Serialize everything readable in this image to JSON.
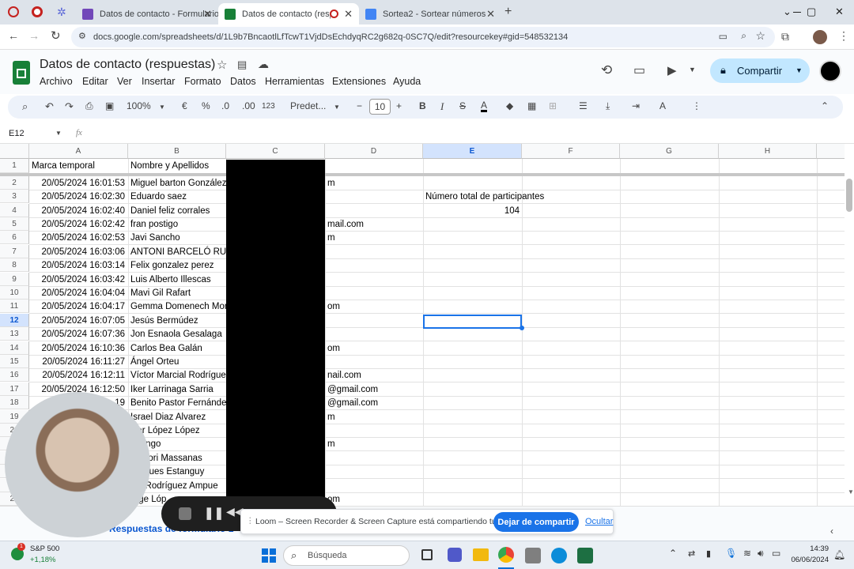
{
  "browser": {
    "tabs": [
      {
        "label": "Datos de contacto - Formulario",
        "active": false,
        "color": "#7248b9"
      },
      {
        "label": "Datos de contacto (respuestas)",
        "active": true,
        "color": "#188038"
      },
      {
        "label": "Sortea2 - Sortear números",
        "active": false,
        "color": "#4285f4"
      }
    ],
    "url": "docs.google.com/spreadsheets/d/1L9b7BncaotlLfTcwT1VjdDsEchdyqRC2g682q-0SC7Q/edit?resourcekey#gid=548532134"
  },
  "app": {
    "title": "Datos de contacto (respuestas)",
    "menu": [
      "Archivo",
      "Editar",
      "Ver",
      "Insertar",
      "Formato",
      "Datos",
      "Herramientas",
      "Extensiones",
      "Ayuda"
    ],
    "share_label": "Compartir",
    "accent": "#c2e7ff"
  },
  "toolbar": {
    "zoom": "100%",
    "currency": "€",
    "percent": "%",
    "dec_less": ".0",
    "dec_more": ".00",
    "number_format": "123",
    "font": "Predet...",
    "font_size": "10"
  },
  "formula_bar": {
    "cell_ref": "E12",
    "fx": "fx"
  },
  "grid": {
    "columns": [
      "A",
      "B",
      "C",
      "D",
      "E",
      "F",
      "G",
      "H"
    ],
    "selected_column": "E",
    "selected_row": 12,
    "rows": [
      {
        "n": 1,
        "a": "Marca temporal",
        "b": "Nombre y Apellidos",
        "d": "",
        "e": ""
      },
      {
        "n": 2,
        "a": "20/05/2024 16:01:53",
        "b": "Miguel barton González",
        "d": "m",
        "e": ""
      },
      {
        "n": 3,
        "a": "20/05/2024 16:02:30",
        "b": "Eduardo saez",
        "d": "",
        "e": "Número total de participantes"
      },
      {
        "n": 4,
        "a": "20/05/2024 16:02:40",
        "b": "Daniel feliz corrales",
        "d": "",
        "e": "104"
      },
      {
        "n": 5,
        "a": "20/05/2024 16:02:42",
        "b": "fran postigo",
        "d": "mail.com",
        "e": ""
      },
      {
        "n": 6,
        "a": "20/05/2024 16:02:53",
        "b": "Javi Sancho",
        "d": "m",
        "e": ""
      },
      {
        "n": 7,
        "a": "20/05/2024 16:03:06",
        "b": "ANTONI BARCELÓ RUB",
        "d": "",
        "e": ""
      },
      {
        "n": 8,
        "a": "20/05/2024 16:03:14",
        "b": "Felix gonzalez perez",
        "d": "",
        "e": ""
      },
      {
        "n": 9,
        "a": "20/05/2024 16:03:42",
        "b": "Luis Alberto Illescas",
        "d": "",
        "e": ""
      },
      {
        "n": 10,
        "a": "20/05/2024 16:04:04",
        "b": "Mavi Gil Rafart",
        "d": "",
        "e": ""
      },
      {
        "n": 11,
        "a": "20/05/2024 16:04:17",
        "b": "Gemma Domenech Mon",
        "d": "om",
        "e": ""
      },
      {
        "n": 12,
        "a": "20/05/2024 16:07:05",
        "b": "Jesús Bermúdez",
        "d": "",
        "e": ""
      },
      {
        "n": 13,
        "a": "20/05/2024 16:07:36",
        "b": "Jon Esnaola Gesalaga",
        "d": "",
        "e": ""
      },
      {
        "n": 14,
        "a": "20/05/2024 16:10:36",
        "b": "Carlos Bea Galán",
        "d": "om",
        "e": ""
      },
      {
        "n": 15,
        "a": "20/05/2024 16:11:27",
        "b": "Ángel Orteu",
        "d": "",
        "e": ""
      },
      {
        "n": 16,
        "a": "20/05/2024 16:12:11",
        "b": "Víctor Marcial Rodríguez",
        "d": "nail.com",
        "e": ""
      },
      {
        "n": 17,
        "a": "20/05/2024 16:12:50",
        "b": "Iker Larrinaga Sarria",
        "d": "@gmail.com",
        "e": ""
      },
      {
        "n": 18,
        "a": "19",
        "b": "Benito Pastor Fernández",
        "d": "@gmail.com",
        "e": ""
      },
      {
        "n": 19,
        "a": "",
        "b": "Israel Diaz Alvarez",
        "d": "m",
        "e": ""
      },
      {
        "n": 20,
        "a": "",
        "b": "vier López López",
        "d": "",
        "e": ""
      },
      {
        "n": 21,
        "a": "",
        "b": "Luengo",
        "d": "m",
        "e": ""
      },
      {
        "n": 22,
        "a": "",
        "b": "Batllori Massanas",
        "d": "",
        "e": ""
      },
      {
        "n": 23,
        "a": "",
        "b": "Artigues Estanguy",
        "d": "",
        "e": ""
      },
      {
        "n": 24,
        "a": "",
        "b": "gio Rodríguez Ampue",
        "d": "",
        "e": ""
      },
      {
        "n": 25,
        "a": "",
        "b": "orge Lóp",
        "d": "om",
        "e": ""
      }
    ]
  },
  "sheet_tab": "Respuestas de formulario 1",
  "loom": {
    "message": "Loom – Screen Recorder & Screen Capture está compartiendo tu pantalla.",
    "stop_label": "Dejar de compartir",
    "hide_label": "Ocultar"
  },
  "taskbar": {
    "stock_name": "S&P 500",
    "stock_change": "+1,18%",
    "search_placeholder": "Búsqueda",
    "time": "14:39",
    "date": "06/06/2024"
  }
}
